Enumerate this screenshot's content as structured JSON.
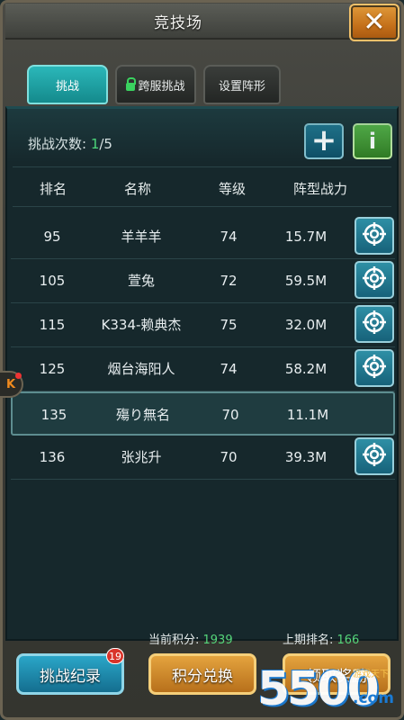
{
  "window": {
    "title": "竞技场",
    "close_icon": "close-icon"
  },
  "tabs": [
    {
      "label": "挑战"
    },
    {
      "label": "跨服挑战",
      "icon": "lock-icon"
    },
    {
      "label": "设置阵形"
    }
  ],
  "challenge": {
    "label": "挑战次数: ",
    "used": "1",
    "total": "/5"
  },
  "columns": {
    "rank": "排名",
    "name": "名称",
    "level": "等级",
    "power": "阵型战力"
  },
  "rows": [
    {
      "rank": "95",
      "name": "羊羊羊",
      "level": "74",
      "power": "15.7M",
      "action": true
    },
    {
      "rank": "105",
      "name": "萱兔",
      "level": "72",
      "power": "59.5M",
      "action": true
    },
    {
      "rank": "115",
      "name": "K334-赖典杰",
      "level": "75",
      "power": "32.0M",
      "action": true
    },
    {
      "rank": "125",
      "name": "烟台海阳人",
      "level": "74",
      "power": "58.2M",
      "action": true
    },
    {
      "rank": "135",
      "name": "殤り無名",
      "level": "70",
      "power": "11.1M",
      "action": false,
      "selected": true
    },
    {
      "rank": "136",
      "name": "张兆升",
      "level": "70",
      "power": "39.3M",
      "action": true
    }
  ],
  "footer": {
    "score_label": "当前积分: ",
    "score_value": "1939",
    "last_rank_label": "上期排名: ",
    "last_rank_value": "166",
    "record_button": "挑战纪录",
    "record_badge": "19",
    "exchange_button": "积分兑换",
    "reward_button": "领取奖励"
  },
  "side": {
    "k_label": "K"
  },
  "watermark": {
    "main": "5500",
    "sub": "游戏天下",
    "com": ".com"
  },
  "colors": {
    "accent": "#2bb7b9",
    "highlight": "#4fe07a",
    "gold": "#e4a33e"
  }
}
